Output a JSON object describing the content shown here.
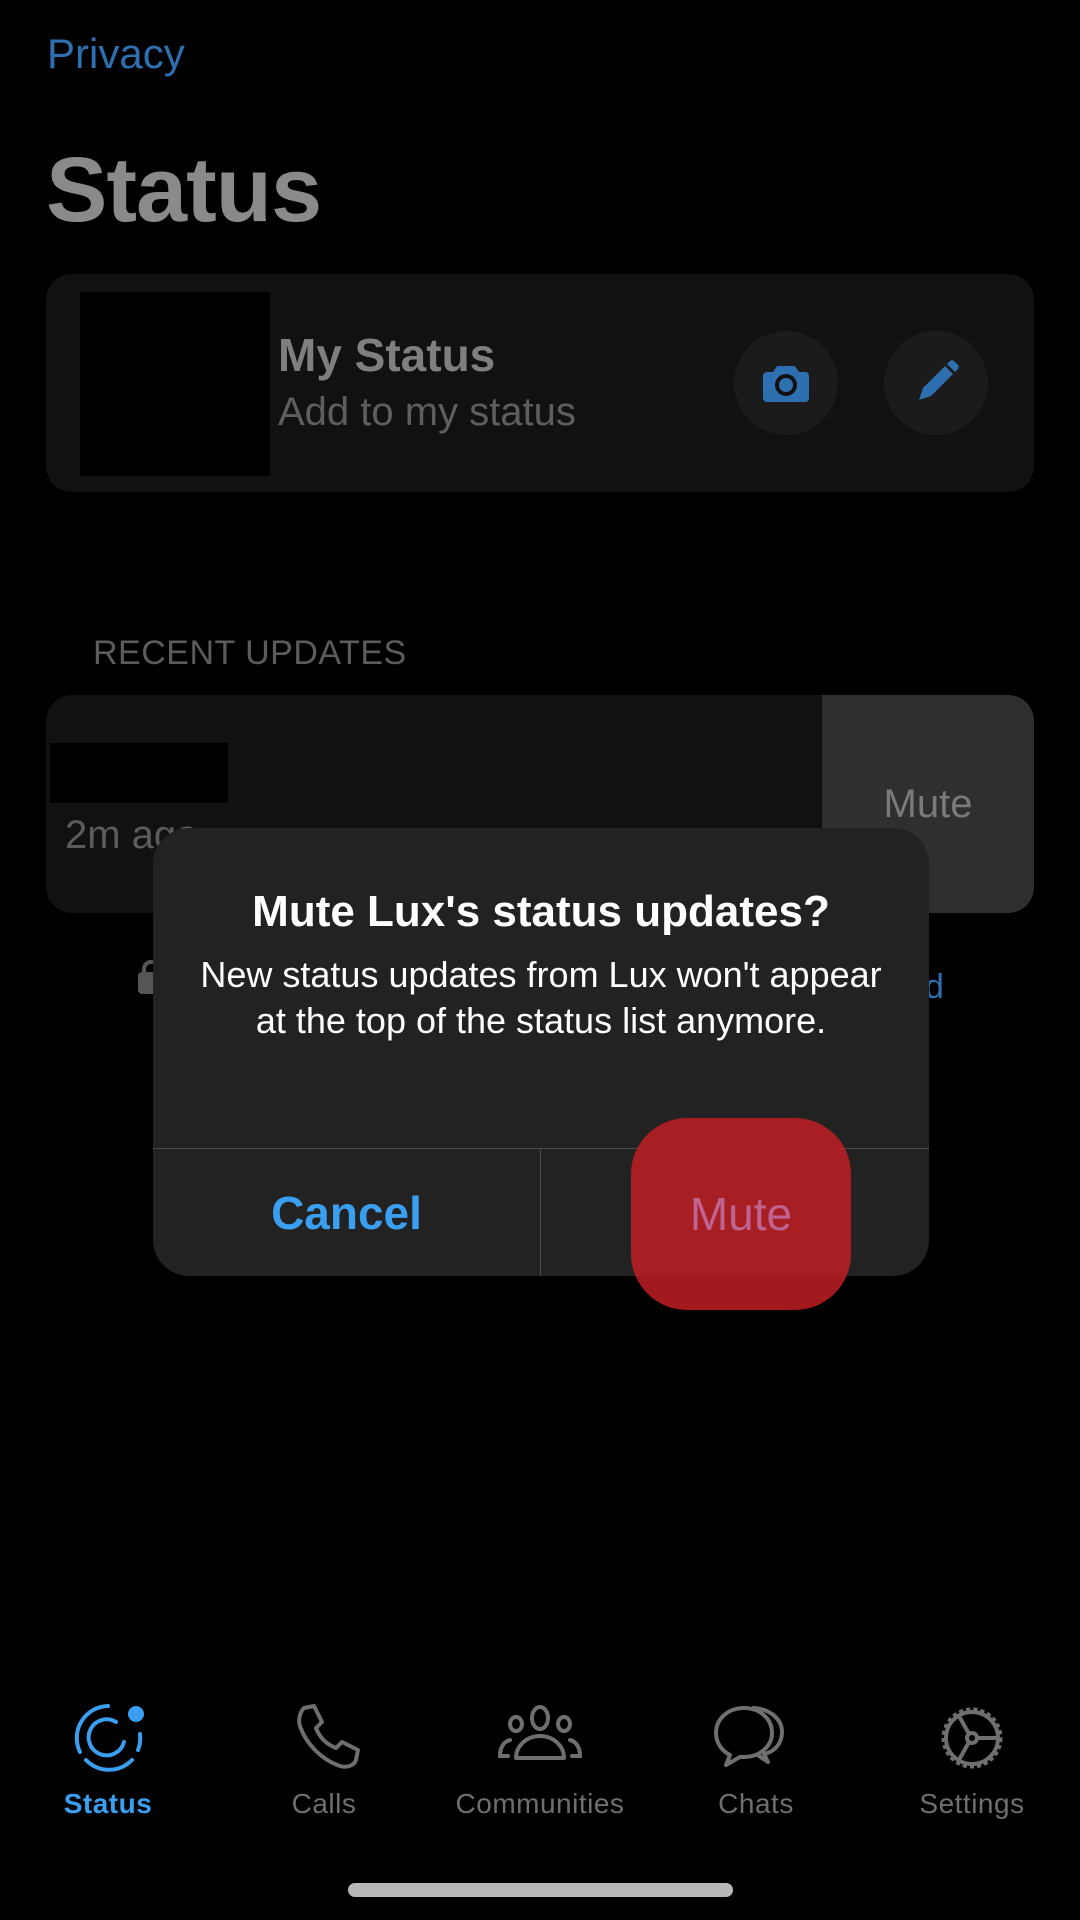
{
  "nav": {
    "back_label": "Privacy"
  },
  "page": {
    "title": "Status"
  },
  "my_status": {
    "name": "My Status",
    "subtitle": "Add to my status",
    "camera_icon": "camera-icon",
    "pencil_icon": "pencil-icon"
  },
  "recent_updates": {
    "header": "RECENT UPDATES",
    "items": [
      {
        "time": "2m ago",
        "swipe_action": "Mute"
      }
    ]
  },
  "partial_link_fragment": "d",
  "alert": {
    "title": "Mute Lux's status updates?",
    "message": "New status updates from Lux won't appear at the top of the status list anymore.",
    "cancel_label": "Cancel",
    "confirm_label": "Mute"
  },
  "tab_bar": {
    "tabs": [
      {
        "label": "Status",
        "icon": "status-icon",
        "active": true
      },
      {
        "label": "Calls",
        "icon": "phone-icon",
        "active": false
      },
      {
        "label": "Communities",
        "icon": "communities-icon",
        "active": false
      },
      {
        "label": "Chats",
        "icon": "chats-icon",
        "active": false
      },
      {
        "label": "Settings",
        "icon": "gear-icon",
        "active": false
      }
    ]
  },
  "colors": {
    "accent": "#3a9ff0",
    "dim_accent": "#2e6fb0",
    "background": "#000000",
    "alert_bg": "#222222",
    "tap_highlight": "#be1e23"
  }
}
